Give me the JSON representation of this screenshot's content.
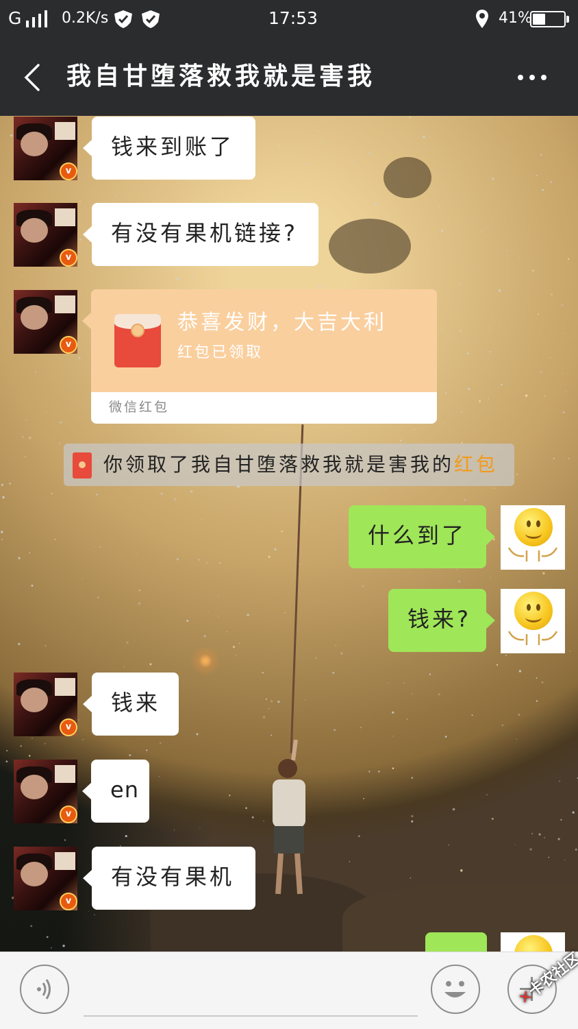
{
  "status_bar": {
    "network": "G",
    "speed": "0.2K/s",
    "time": "17:53",
    "battery": "41%",
    "battery_level": 0.41
  },
  "header": {
    "back_icon": "chevron-left-icon",
    "title": "我自甘堕落救我就是害我",
    "more_icon": "more-dots-icon"
  },
  "messages": [
    {
      "side": "left",
      "text": "钱来到账了"
    },
    {
      "side": "left",
      "text": "有没有果机链接?"
    },
    {
      "side": "left",
      "type": "red_packet",
      "title": "恭喜发财，大吉大利",
      "status": "红包已领取",
      "label": "微信红包"
    },
    {
      "side": "system",
      "text": "你领取了我自甘堕落救我就是害我的",
      "link": "红包"
    },
    {
      "side": "right",
      "text": "什么到了"
    },
    {
      "side": "right",
      "text": "钱来?"
    },
    {
      "side": "left",
      "text": "钱来"
    },
    {
      "side": "left",
      "text": "en"
    },
    {
      "side": "left",
      "text": "有没有果机"
    }
  ],
  "input_bar": {
    "voice_icon": "voice-icon",
    "emoji_icon": "emoji-icon",
    "plus_icon": "plus-icon"
  },
  "watermark": "卡农社区",
  "colors": {
    "bar": "#2b2c2e",
    "bubble_in": "#ffffff",
    "bubble_out": "#9fe658",
    "red_packet": "#facf9e",
    "link": "#f39a19"
  }
}
